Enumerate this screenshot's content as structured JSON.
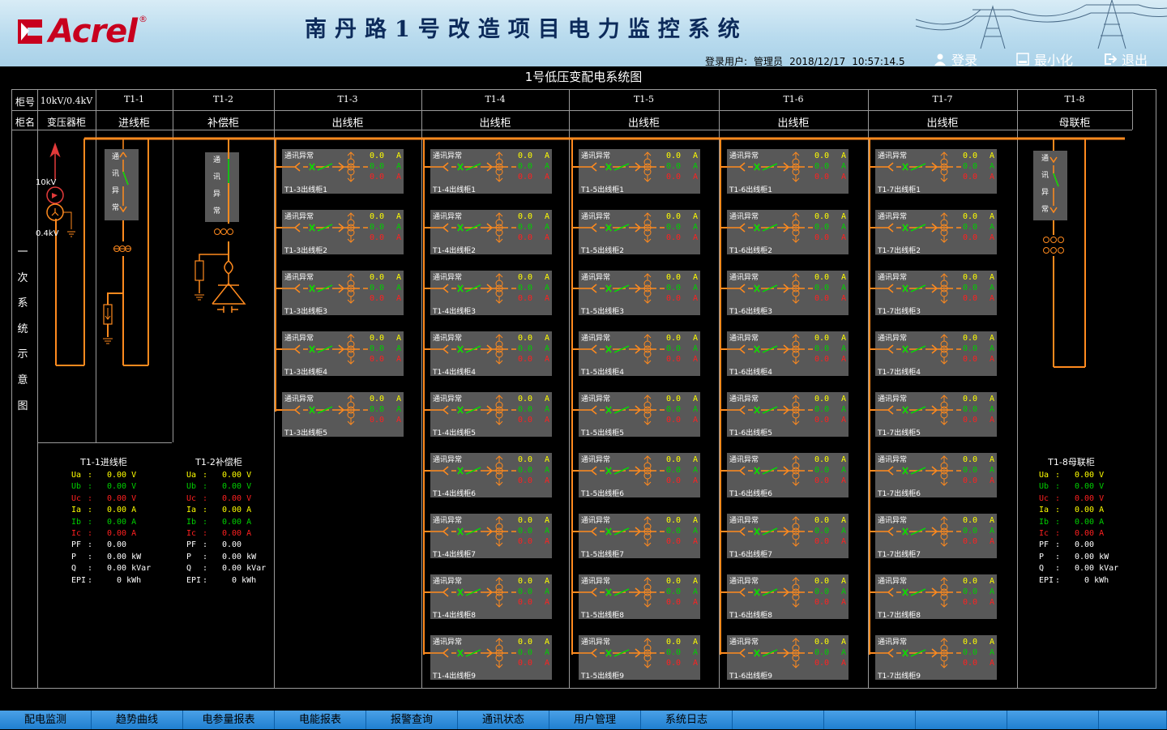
{
  "header": {
    "logo_text": "Acrel",
    "logo_reg": "®",
    "title": "南丹路1号改造项目电力监控系统",
    "login_label": "登录用户:",
    "user": "管理员",
    "date": "2018/12/17",
    "time": "10:57:14.5",
    "btn_login": "登录",
    "btn_minimize": "最小化",
    "btn_logout": "退出",
    "brand_color": "#c8001e"
  },
  "page_title": "1号低压变配电系统图",
  "table_header": {
    "row1_label": "柜号",
    "row2_label": "柜名",
    "voltage": "10kV/0.4kV",
    "transformer": "变压器柜",
    "columns": [
      {
        "id": "T1-1",
        "name": "进线柜"
      },
      {
        "id": "T1-2",
        "name": "补偿柜"
      },
      {
        "id": "T1-3",
        "name": "出线柜"
      },
      {
        "id": "T1-4",
        "name": "出线柜"
      },
      {
        "id": "T1-5",
        "name": "出线柜"
      },
      {
        "id": "T1-6",
        "name": "出线柜"
      },
      {
        "id": "T1-7",
        "name": "出线柜"
      },
      {
        "id": "T1-8",
        "name": "母联柜"
      }
    ]
  },
  "side_label": [
    "一",
    "次",
    "系",
    "统",
    "示",
    "意",
    "图"
  ],
  "diagram_labels": {
    "hv": "10kV",
    "lv": "0.4kV",
    "comm_vertical": [
      "通",
      "讯",
      "异",
      "常"
    ]
  },
  "panel_status": "通讯异常",
  "panel_values": [
    "0.0",
    "0.0",
    "0.0"
  ],
  "panel_unit": "A",
  "feeder_groups": [
    {
      "prefix": "T1-3出线柜",
      "count": 5
    },
    {
      "prefix": "T1-4出线柜",
      "count": 9
    },
    {
      "prefix": "T1-5出线柜",
      "count": 9
    },
    {
      "prefix": "T1-6出线柜",
      "count": 9
    },
    {
      "prefix": "T1-7出线柜",
      "count": 9
    }
  ],
  "meters": [
    {
      "title": "T1-1进线柜",
      "rows": [
        {
          "label": "Ua",
          "value": "0.00 V",
          "color": "#ffff00"
        },
        {
          "label": "Ub",
          "value": "0.00 V",
          "color": "#00d000"
        },
        {
          "label": "Uc",
          "value": "0.00 V",
          "color": "#ff2020"
        },
        {
          "label": "Ia",
          "value": "0.00 A",
          "color": "#ffff00"
        },
        {
          "label": "Ib",
          "value": "0.00 A",
          "color": "#00d000"
        },
        {
          "label": "Ic",
          "value": "0.00 A",
          "color": "#ff2020"
        },
        {
          "label": "PF",
          "value": "0.00",
          "color": "#ffffff"
        },
        {
          "label": "P",
          "value": "0.00 kW",
          "color": "#ffffff"
        },
        {
          "label": "Q",
          "value": "0.00 kVar",
          "color": "#ffffff"
        },
        {
          "label": "EPI",
          "value": "  0 kWh",
          "color": "#ffffff"
        }
      ]
    },
    {
      "title": "T1-2补偿柜",
      "rows": [
        {
          "label": "Ua",
          "value": "0.00 V",
          "color": "#ffff00"
        },
        {
          "label": "Ub",
          "value": "0.00 V",
          "color": "#00d000"
        },
        {
          "label": "Uc",
          "value": "0.00 V",
          "color": "#ff2020"
        },
        {
          "label": "Ia",
          "value": "0.00 A",
          "color": "#ffff00"
        },
        {
          "label": "Ib",
          "value": "0.00 A",
          "color": "#00d000"
        },
        {
          "label": "Ic",
          "value": "0.00 A",
          "color": "#ff2020"
        },
        {
          "label": "PF",
          "value": "0.00",
          "color": "#ffffff"
        },
        {
          "label": "P",
          "value": "0.00 kW",
          "color": "#ffffff"
        },
        {
          "label": "Q",
          "value": "0.00 kVar",
          "color": "#ffffff"
        },
        {
          "label": "EPI",
          "value": "  0 kWh",
          "color": "#ffffff"
        }
      ]
    },
    {
      "title": "T1-8母联柜",
      "rows": [
        {
          "label": "Ua",
          "value": "0.00 V",
          "color": "#ffff00"
        },
        {
          "label": "Ub",
          "value": "0.00 V",
          "color": "#00d000"
        },
        {
          "label": "Uc",
          "value": "0.00 V",
          "color": "#ff2020"
        },
        {
          "label": "Ia",
          "value": "0.00 A",
          "color": "#ffff00"
        },
        {
          "label": "Ib",
          "value": "0.00 A",
          "color": "#00d000"
        },
        {
          "label": "Ic",
          "value": "0.00 A",
          "color": "#ff2020"
        },
        {
          "label": "PF",
          "value": "0.00",
          "color": "#ffffff"
        },
        {
          "label": "P",
          "value": "0.00 kW",
          "color": "#ffffff"
        },
        {
          "label": "Q",
          "value": "0.00 kVar",
          "color": "#ffffff"
        },
        {
          "label": "EPI",
          "value": "  0 kWh",
          "color": "#ffffff"
        }
      ]
    }
  ],
  "nav": [
    "配电监测",
    "趋势曲线",
    "电参量报表",
    "电能报表",
    "报警查询",
    "通讯状态",
    "用户管理",
    "系统日志",
    "",
    "",
    "",
    "",
    ""
  ],
  "colors": {
    "bus": "#ff8a1e",
    "switch_on": "#00e000",
    "phase_a": "#ffff00",
    "phase_b": "#00d000",
    "phase_c": "#ff2020",
    "panel_bg": "#585858"
  }
}
